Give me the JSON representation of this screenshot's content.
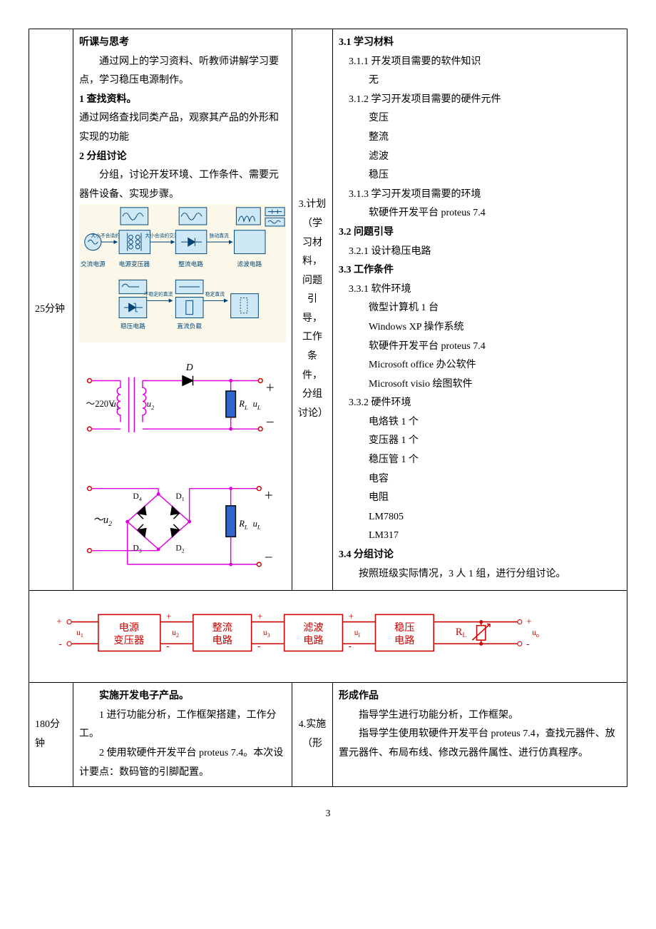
{
  "row1": {
    "time": "25分钟",
    "left": {
      "h1": "听课与思考",
      "p1": "通过网上的学习资料、听教师讲解学习要点，学习稳压电源制作。",
      "h2": "1 查找资料。",
      "p2": "通过网络查找同类产品，观察其产品的外形和实现的功能",
      "h3": "2 分组讨论",
      "p3": "分组，讨论开发环境、工作条件、需要元器件设备、实现步骤。",
      "dia1": {
        "ac_src": "交流电源",
        "big_ac": "大小不合适的交流",
        "trans": "电源变压器",
        "ok_ac": "大小合适的交流",
        "rect": "整流电路",
        "pulse": "脉动直流",
        "filter": "滤波电路",
        "unstable": "不稳定的直流",
        "vreg": "稳压电路",
        "stable": "稳定直流",
        "load": "直流负载"
      },
      "dia2": {
        "src": "～220V",
        "u1": "u",
        "u1s": "1",
        "u2": "u",
        "u2s": "2",
        "D": "D",
        "RL": "R",
        "RLs": "L",
        "uL": "u",
        "uLs": "L",
        "plus": "＋",
        "minus": "－"
      },
      "dia3": {
        "u2": "～u",
        "u2s": "2",
        "D1": "D",
        "D1s": "1",
        "D2": "D",
        "D2s": "2",
        "D3": "D",
        "D3s": "3",
        "D4": "D",
        "D4s": "4",
        "RL": "R",
        "RLs": "L",
        "uL": "u",
        "uLs": "L",
        "plus": "＋",
        "minus": "－"
      }
    },
    "mid": "3.计划（学习材料，问题引导，工作条件，分组讨论）",
    "right": {
      "h31": "3.1 学习材料",
      "l311": "3.1.1 开发项目需要的软件知识",
      "l311a": "无",
      "l312": "3.1.2 学习开发项目需要的硬件元件",
      "l312a": "变压",
      "l312b": "整流",
      "l312c": "滤波",
      "l312d": "稳压",
      "l313": "3.1.3 学习开发项目需要的环境",
      "l313a": "软硬件开发平台 proteus 7.4",
      "h32": "3.2 问题引导",
      "l321": "3.2.1 设计稳压电路",
      "h33": "3.3 工作条件",
      "l331": "3.3.1 软件环境",
      "l331a": "微型计算机 1 台",
      "l331b": "Windows XP 操作系统",
      "l331c": "软硬件开发平台 proteus 7.4",
      "l331d": "Microsoft office 办公软件",
      "l331e": "Microsoft visio 绘图软件",
      "l332": "3.3.2 硬件环境",
      "l332a": "电烙铁 1 个",
      "l332b": "变压器 1 个",
      "l332c": "稳压管 1 个",
      "l332d": "电容",
      "l332e": "电阻",
      "l332f": "LM7805",
      "l332g": "LM317",
      "h34": "3.4 分组讨论",
      "p34": "按照班级实际情况，3 人 1 组，进行分组讨论。"
    }
  },
  "row2": {
    "flow": {
      "b1": "电源变压器",
      "b2": "整流电路",
      "b3": "滤波电路",
      "b4": "稳压电路",
      "u1": "u",
      "u1s": "1",
      "u2": "u",
      "u2s": "2",
      "u3": "u",
      "u3s": "3",
      "uI": "u",
      "uIs": "I",
      "uo": "u",
      "uos": "o",
      "RL": "R",
      "RLs": "L",
      "plus": "+",
      "minus": "-"
    }
  },
  "row3": {
    "time": "180分钟",
    "left": {
      "h": "实施开发电子产品。",
      "p1": "1 进行功能分析，工作框架搭建，工作分工。",
      "p2": "2 使用软硬件开发平台 proteus 7.4。本次设计要点：数码管的引脚配置。"
    },
    "mid": "4.实施（形",
    "right": {
      "h": "形成作品",
      "p1": "指导学生进行功能分析，工作框架。",
      "p2": "指导学生使用软硬件开发平台 proteus 7.4，查找元器件、放置元器件、布局布线、修改元器件属性、进行仿真程序。"
    }
  },
  "page": "3"
}
